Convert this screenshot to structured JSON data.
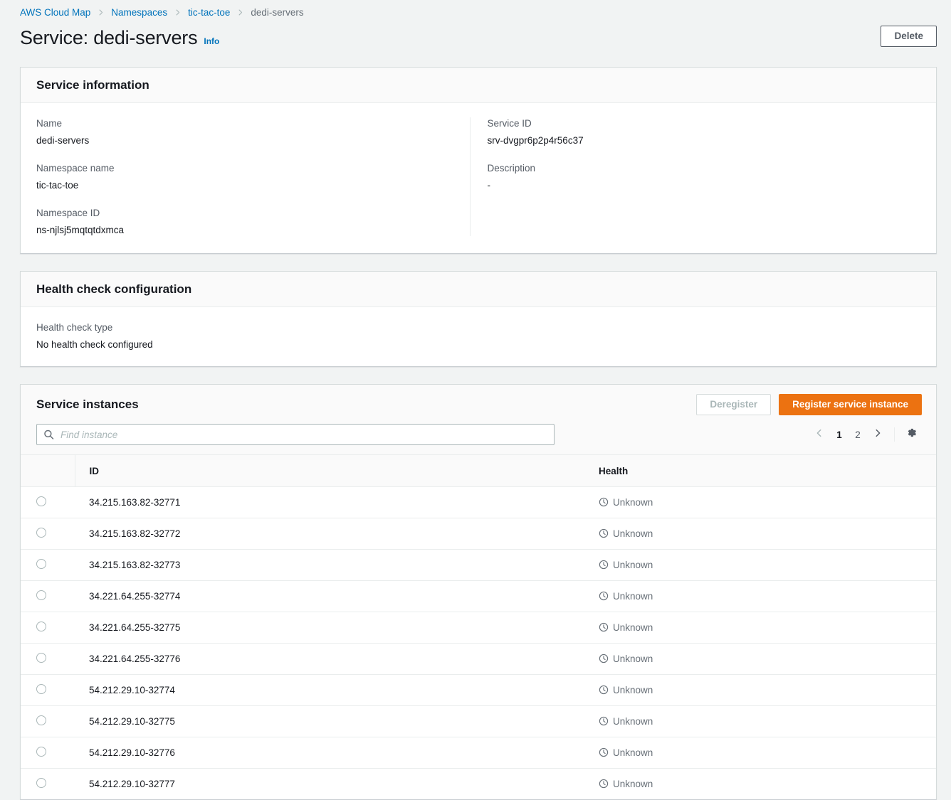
{
  "breadcrumb": {
    "items": [
      {
        "label": "AWS Cloud Map",
        "current": false
      },
      {
        "label": "Namespaces",
        "current": false
      },
      {
        "label": "tic-tac-toe",
        "current": false
      },
      {
        "label": "dedi-servers",
        "current": true
      }
    ]
  },
  "header": {
    "title": "Service: dedi-servers",
    "info_label": "Info",
    "delete_label": "Delete"
  },
  "service_information": {
    "panel_title": "Service information",
    "fields": [
      {
        "label": "Name",
        "value": "dedi-servers"
      },
      {
        "label": "Namespace name",
        "value": "tic-tac-toe"
      },
      {
        "label": "Namespace ID",
        "value": "ns-njlsj5mqtqtdxmca"
      },
      {
        "label": "Service ID",
        "value": "srv-dvgpr6p2p4r56c37"
      },
      {
        "label": "Description",
        "value": "-"
      }
    ]
  },
  "health_check_configuration": {
    "panel_title": "Health check configuration",
    "fields": [
      {
        "label": "Health check type",
        "value": "No health check configured"
      }
    ]
  },
  "service_instances": {
    "panel_title": "Service instances",
    "deregister_label": "Deregister",
    "register_label": "Register service instance",
    "search": {
      "placeholder": "Find instance",
      "value": "",
      "icon": "search-icon"
    },
    "pagination": {
      "prev_icon": "chevron-left-icon",
      "next_icon": "chevron-right-icon",
      "pages": [
        "1",
        "2"
      ],
      "current_page": "1",
      "settings_icon": "gear-icon"
    },
    "columns": [
      "",
      "ID",
      "Health"
    ],
    "rows": [
      {
        "id": "34.215.163.82-32771",
        "health": "Unknown",
        "health_icon": "pending-clock-icon"
      },
      {
        "id": "34.215.163.82-32772",
        "health": "Unknown",
        "health_icon": "pending-clock-icon"
      },
      {
        "id": "34.215.163.82-32773",
        "health": "Unknown",
        "health_icon": "pending-clock-icon"
      },
      {
        "id": "34.221.64.255-32774",
        "health": "Unknown",
        "health_icon": "pending-clock-icon"
      },
      {
        "id": "34.221.64.255-32775",
        "health": "Unknown",
        "health_icon": "pending-clock-icon"
      },
      {
        "id": "34.221.64.255-32776",
        "health": "Unknown",
        "health_icon": "pending-clock-icon"
      },
      {
        "id": "54.212.29.10-32774",
        "health": "Unknown",
        "health_icon": "pending-clock-icon"
      },
      {
        "id": "54.212.29.10-32775",
        "health": "Unknown",
        "health_icon": "pending-clock-icon"
      },
      {
        "id": "54.212.29.10-32776",
        "health": "Unknown",
        "health_icon": "pending-clock-icon"
      },
      {
        "id": "54.212.29.10-32777",
        "health": "Unknown",
        "health_icon": "pending-clock-icon"
      }
    ]
  },
  "colors": {
    "page_background": "#f1f3f3",
    "panel_background": "#ffffff",
    "panel_header_background": "#fafafa",
    "link": "#0073bb",
    "primary_button": "#ec7211",
    "text": "#16191f",
    "secondary_text": "#545b64",
    "muted_text": "#687078",
    "border": "#eaeded"
  }
}
